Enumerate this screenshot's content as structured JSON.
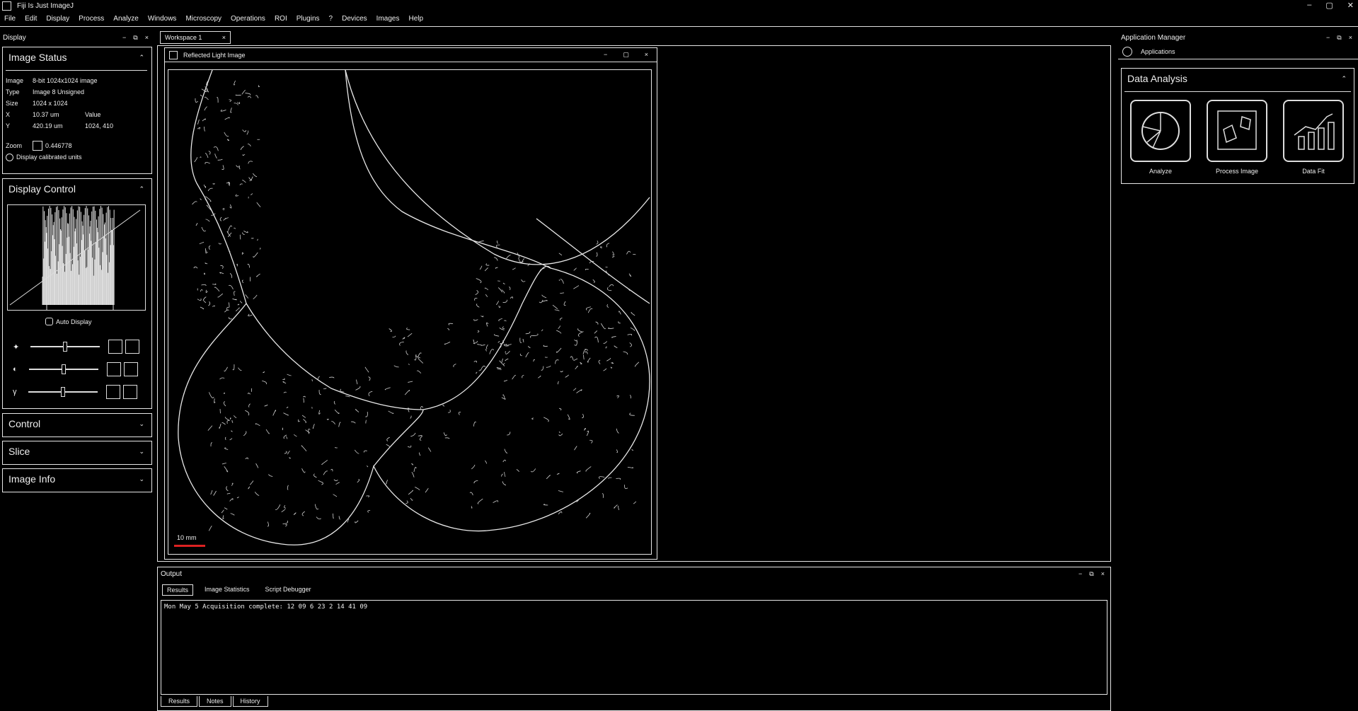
{
  "window": {
    "title": "Fiji Is Just ImageJ",
    "buttons": [
      "–",
      "▢",
      "✕"
    ]
  },
  "menu": [
    "File",
    "Edit",
    "Display",
    "Process",
    "Analyze",
    "Windows",
    "Microscopy",
    "Operations",
    "ROI",
    "Plugins",
    "?",
    "Devices",
    "Images",
    "Help"
  ],
  "left": {
    "panel_title": "Display",
    "image_status": {
      "title": "Image Status",
      "rows": [
        {
          "k": "Image",
          "v": "8-bit 1024x1024 image"
        },
        {
          "k": "Type",
          "v": "Image 8 Unsigned"
        },
        {
          "k": "Size",
          "v": "1024 x 1024"
        },
        {
          "k": "X",
          "v": "10.37 um",
          "k2": "Value"
        },
        {
          "k": "Y",
          "v": "420.19 um",
          "v2": "1024, 410"
        }
      ],
      "zoom_label": "Zoom",
      "zoom_value": "0.446778",
      "checkbox_label": "Display calibrated units"
    },
    "display_control": {
      "title": "Display Control",
      "auto_label": "Auto Display"
    },
    "sections": [
      "Control",
      "Slice",
      "Image Info"
    ]
  },
  "document_tab": "Workspace 1",
  "viewer": {
    "title": "Reflected Light Image",
    "scale_label": "10 mm"
  },
  "right": {
    "panel_title": "Application Manager",
    "sub_title": "Applications",
    "section_title": "Data Analysis",
    "tiles": [
      {
        "label": "Analyze",
        "icon": "pie-chart-icon"
      },
      {
        "label": "Process Image",
        "icon": "shapes-icon"
      },
      {
        "label": "Data Fit",
        "icon": "bar-trend-icon"
      }
    ]
  },
  "output": {
    "title": "Output",
    "tabs": [
      "Results",
      "Image Statistics",
      "Script Debugger"
    ],
    "log_line": "Mon May 5 Acquisition complete: 12 09 6 23 2 14 41 09",
    "bottom_tabs": [
      "Results",
      "Notes",
      "History"
    ]
  }
}
